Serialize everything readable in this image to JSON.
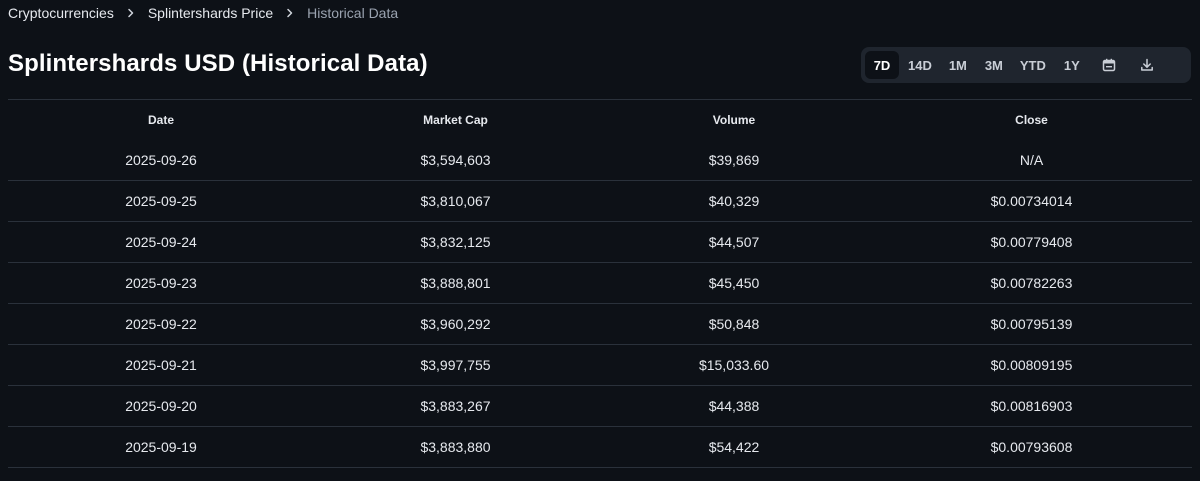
{
  "breadcrumb": [
    {
      "label": "Cryptocurrencies"
    },
    {
      "label": "Splintershards Price"
    },
    {
      "label": "Historical Data"
    }
  ],
  "title": "Splintershards USD (Historical Data)",
  "ranges": [
    {
      "label": "7D",
      "active": true
    },
    {
      "label": "14D"
    },
    {
      "label": "1M"
    },
    {
      "label": "3M"
    },
    {
      "label": "YTD"
    },
    {
      "label": "1Y"
    }
  ],
  "icons": {
    "calendar": "calendar-icon",
    "download": "download-icon"
  },
  "colors": {
    "background": "#0d1117",
    "control_bg": "#1f252e",
    "border": "#2a313b",
    "text": "#e6e9ee"
  },
  "table": {
    "columns": [
      "Date",
      "Market Cap",
      "Volume",
      "Close"
    ],
    "rows": [
      [
        "2025-09-26",
        "$3,594,603",
        "$39,869",
        "N/A"
      ],
      [
        "2025-09-25",
        "$3,810,067",
        "$40,329",
        "$0.00734014"
      ],
      [
        "2025-09-24",
        "$3,832,125",
        "$44,507",
        "$0.00779408"
      ],
      [
        "2025-09-23",
        "$3,888,801",
        "$45,450",
        "$0.00782263"
      ],
      [
        "2025-09-22",
        "$3,960,292",
        "$50,848",
        "$0.00795139"
      ],
      [
        "2025-09-21",
        "$3,997,755",
        "$15,033.60",
        "$0.00809195"
      ],
      [
        "2025-09-20",
        "$3,883,267",
        "$44,388",
        "$0.00816903"
      ],
      [
        "2025-09-19",
        "$3,883,880",
        "$54,422",
        "$0.00793608"
      ]
    ]
  }
}
